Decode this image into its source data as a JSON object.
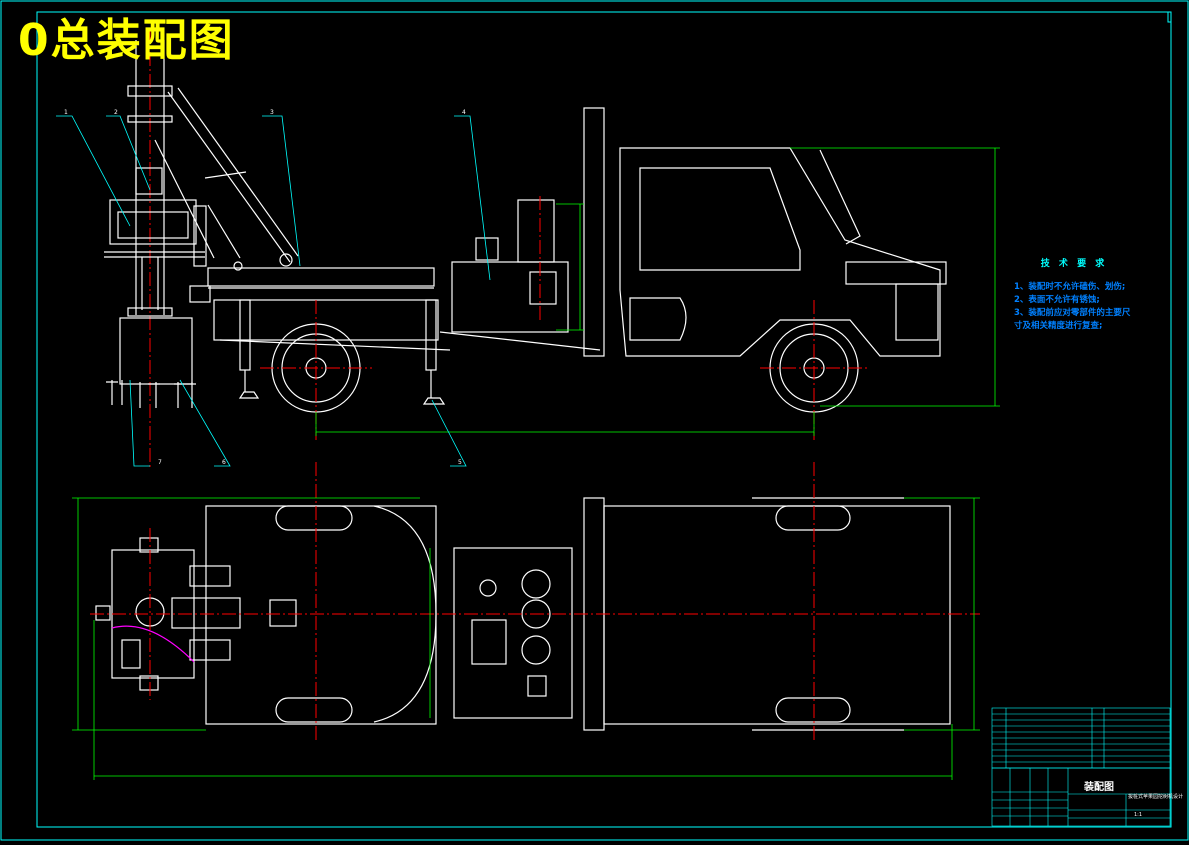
{
  "title": "0总装配图",
  "technical_requirements": {
    "heading": "技 术 要 求",
    "items": [
      "1、装配时不允许磕伤、划伤;",
      "2、表面不允许有锈蚀;",
      "3、装配前应对零部件的主要尺寸及相关精度进行复查;"
    ]
  },
  "part_balloons": [
    "1",
    "2",
    "3",
    "4",
    "5",
    "6",
    "7"
  ],
  "title_block": {
    "drawing_name": "装配图",
    "project_name": "拔桩式苹果园挖树机设计",
    "scale": "1:1"
  },
  "colors": {
    "background": "#000000",
    "outline": "#ffffff",
    "dimension": "#00ff00",
    "centerline": "#ff0000",
    "leader": "#00ffff",
    "title": "#ffff00",
    "cable": "#ff00ff"
  }
}
